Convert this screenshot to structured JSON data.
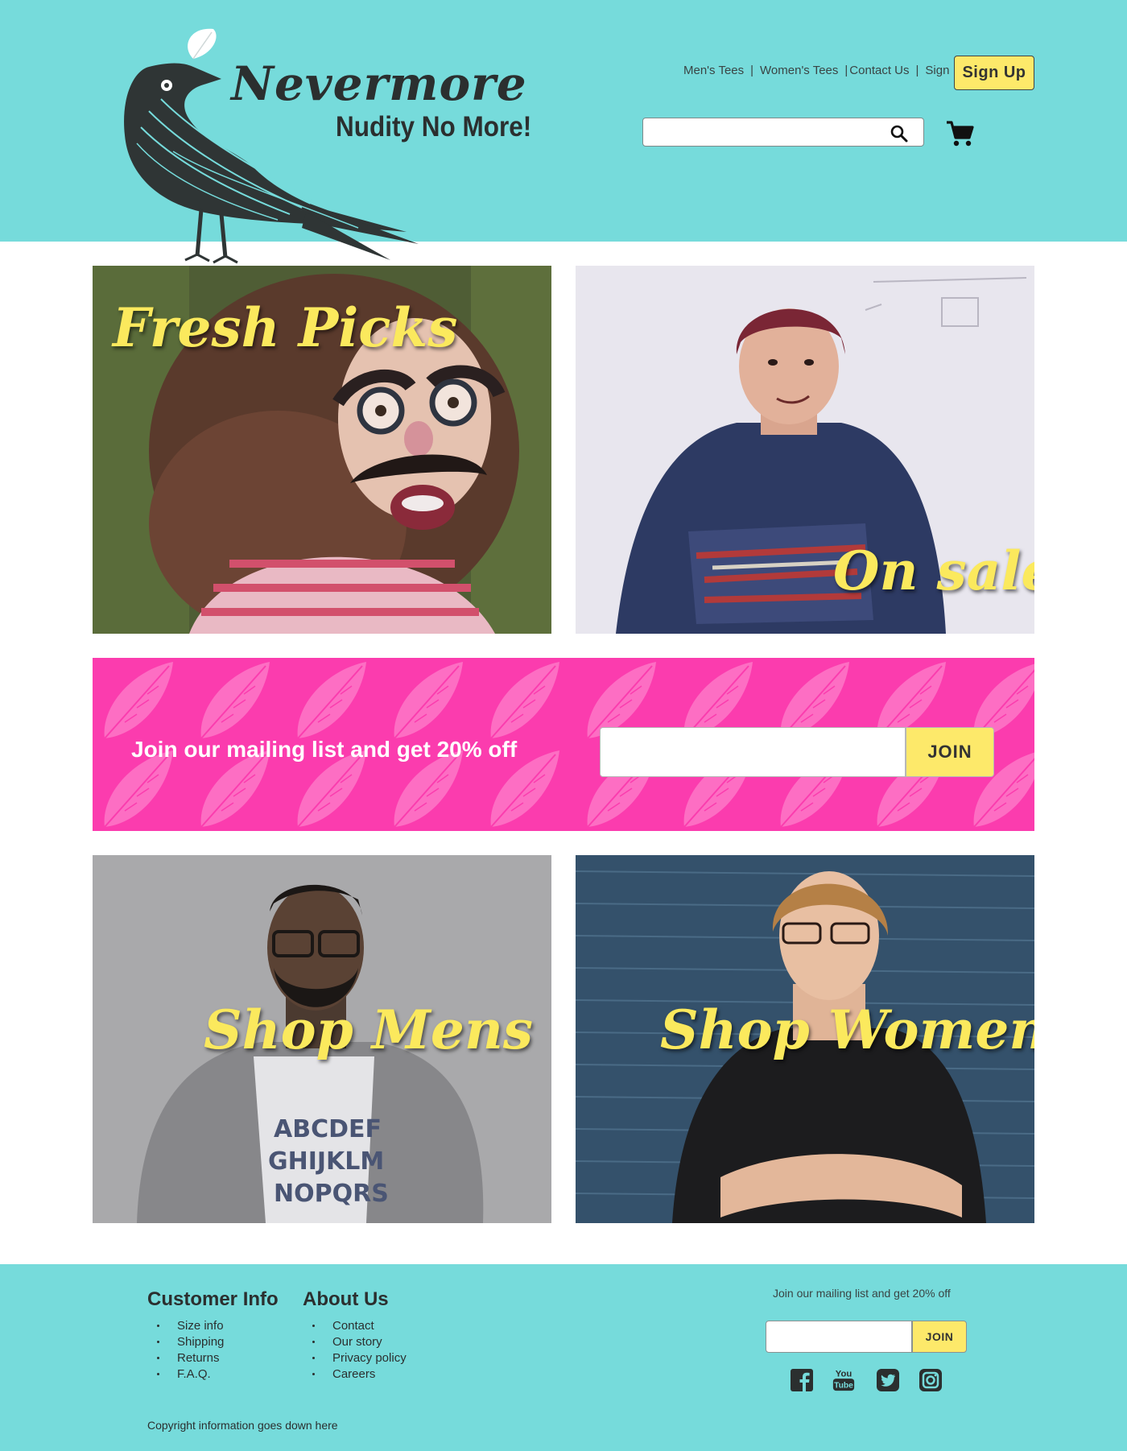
{
  "brand": {
    "name": "Nevermore",
    "tagline": "Nudity No More!"
  },
  "nav": {
    "items": [
      "Men's Tees",
      "Women's Tees",
      "Contact Us",
      "Sign In"
    ],
    "separator": "|",
    "signup_label": "Sign Up"
  },
  "search": {
    "placeholder": "",
    "icon": "search-icon"
  },
  "cart": {
    "icon": "shopping-cart-icon"
  },
  "tiles": {
    "fresh": "Fresh Picks",
    "sale": "On sale",
    "mens": "Shop Mens",
    "womens": "Shop Womens"
  },
  "mailing": {
    "text": "Join our mailing list and get 20% off",
    "placeholder": "",
    "button": "JOIN"
  },
  "footer": {
    "customer_info": {
      "title": "Customer Info",
      "items": [
        "Size info",
        "Shipping",
        "Returns",
        "F.A.Q."
      ]
    },
    "about_us": {
      "title": "About Us",
      "items": [
        "Contact",
        "Our story",
        "Privacy policy",
        "Careers"
      ]
    },
    "mailing_text": "Join our mailing list and get 20% off",
    "mailing_button": "JOIN",
    "social": [
      "facebook-icon",
      "youtube-icon",
      "twitter-icon",
      "instagram-icon"
    ],
    "youtube_text": [
      "You",
      "Tube"
    ],
    "copyright": "Copyright information goes down here"
  },
  "colors": {
    "teal": "#76dbdb",
    "yellow": "#fde96a",
    "pink": "#fb3cae",
    "dark": "#2b2f2f"
  }
}
